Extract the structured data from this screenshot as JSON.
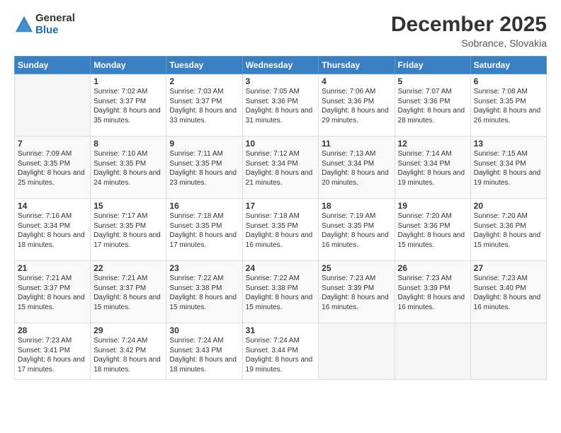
{
  "header": {
    "logo_general": "General",
    "logo_blue": "Blue",
    "month": "December 2025",
    "location": "Sobrance, Slovakia"
  },
  "days_of_week": [
    "Sunday",
    "Monday",
    "Tuesday",
    "Wednesday",
    "Thursday",
    "Friday",
    "Saturday"
  ],
  "weeks": [
    [
      {
        "day": "",
        "sunrise": "",
        "sunset": "",
        "daylight": ""
      },
      {
        "day": "1",
        "sunrise": "7:02 AM",
        "sunset": "3:37 PM",
        "daylight": "8 hours and 35 minutes."
      },
      {
        "day": "2",
        "sunrise": "7:03 AM",
        "sunset": "3:37 PM",
        "daylight": "8 hours and 33 minutes."
      },
      {
        "day": "3",
        "sunrise": "7:05 AM",
        "sunset": "3:36 PM",
        "daylight": "8 hours and 31 minutes."
      },
      {
        "day": "4",
        "sunrise": "7:06 AM",
        "sunset": "3:36 PM",
        "daylight": "8 hours and 29 minutes."
      },
      {
        "day": "5",
        "sunrise": "7:07 AM",
        "sunset": "3:36 PM",
        "daylight": "8 hours and 28 minutes."
      },
      {
        "day": "6",
        "sunrise": "7:08 AM",
        "sunset": "3:35 PM",
        "daylight": "8 hours and 26 minutes."
      }
    ],
    [
      {
        "day": "7",
        "sunrise": "7:09 AM",
        "sunset": "3:35 PM",
        "daylight": "8 hours and 25 minutes."
      },
      {
        "day": "8",
        "sunrise": "7:10 AM",
        "sunset": "3:35 PM",
        "daylight": "8 hours and 24 minutes."
      },
      {
        "day": "9",
        "sunrise": "7:11 AM",
        "sunset": "3:35 PM",
        "daylight": "8 hours and 23 minutes."
      },
      {
        "day": "10",
        "sunrise": "7:12 AM",
        "sunset": "3:34 PM",
        "daylight": "8 hours and 21 minutes."
      },
      {
        "day": "11",
        "sunrise": "7:13 AM",
        "sunset": "3:34 PM",
        "daylight": "8 hours and 20 minutes."
      },
      {
        "day": "12",
        "sunrise": "7:14 AM",
        "sunset": "3:34 PM",
        "daylight": "8 hours and 19 minutes."
      },
      {
        "day": "13",
        "sunrise": "7:15 AM",
        "sunset": "3:34 PM",
        "daylight": "8 hours and 19 minutes."
      }
    ],
    [
      {
        "day": "14",
        "sunrise": "7:16 AM",
        "sunset": "3:34 PM",
        "daylight": "8 hours and 18 minutes."
      },
      {
        "day": "15",
        "sunrise": "7:17 AM",
        "sunset": "3:35 PM",
        "daylight": "8 hours and 17 minutes."
      },
      {
        "day": "16",
        "sunrise": "7:18 AM",
        "sunset": "3:35 PM",
        "daylight": "8 hours and 17 minutes."
      },
      {
        "day": "17",
        "sunrise": "7:18 AM",
        "sunset": "3:35 PM",
        "daylight": "8 hours and 16 minutes."
      },
      {
        "day": "18",
        "sunrise": "7:19 AM",
        "sunset": "3:35 PM",
        "daylight": "8 hours and 16 minutes."
      },
      {
        "day": "19",
        "sunrise": "7:20 AM",
        "sunset": "3:36 PM",
        "daylight": "8 hours and 15 minutes."
      },
      {
        "day": "20",
        "sunrise": "7:20 AM",
        "sunset": "3:36 PM",
        "daylight": "8 hours and 15 minutes."
      }
    ],
    [
      {
        "day": "21",
        "sunrise": "7:21 AM",
        "sunset": "3:37 PM",
        "daylight": "8 hours and 15 minutes."
      },
      {
        "day": "22",
        "sunrise": "7:21 AM",
        "sunset": "3:37 PM",
        "daylight": "8 hours and 15 minutes."
      },
      {
        "day": "23",
        "sunrise": "7:22 AM",
        "sunset": "3:38 PM",
        "daylight": "8 hours and 15 minutes."
      },
      {
        "day": "24",
        "sunrise": "7:22 AM",
        "sunset": "3:38 PM",
        "daylight": "8 hours and 15 minutes."
      },
      {
        "day": "25",
        "sunrise": "7:23 AM",
        "sunset": "3:39 PM",
        "daylight": "8 hours and 16 minutes."
      },
      {
        "day": "26",
        "sunrise": "7:23 AM",
        "sunset": "3:39 PM",
        "daylight": "8 hours and 16 minutes."
      },
      {
        "day": "27",
        "sunrise": "7:23 AM",
        "sunset": "3:40 PM",
        "daylight": "8 hours and 16 minutes."
      }
    ],
    [
      {
        "day": "28",
        "sunrise": "7:23 AM",
        "sunset": "3:41 PM",
        "daylight": "8 hours and 17 minutes."
      },
      {
        "day": "29",
        "sunrise": "7:24 AM",
        "sunset": "3:42 PM",
        "daylight": "8 hours and 18 minutes."
      },
      {
        "day": "30",
        "sunrise": "7:24 AM",
        "sunset": "3:43 PM",
        "daylight": "8 hours and 18 minutes."
      },
      {
        "day": "31",
        "sunrise": "7:24 AM",
        "sunset": "3:44 PM",
        "daylight": "8 hours and 19 minutes."
      },
      {
        "day": "",
        "sunrise": "",
        "sunset": "",
        "daylight": ""
      },
      {
        "day": "",
        "sunrise": "",
        "sunset": "",
        "daylight": ""
      },
      {
        "day": "",
        "sunrise": "",
        "sunset": "",
        "daylight": ""
      }
    ]
  ]
}
